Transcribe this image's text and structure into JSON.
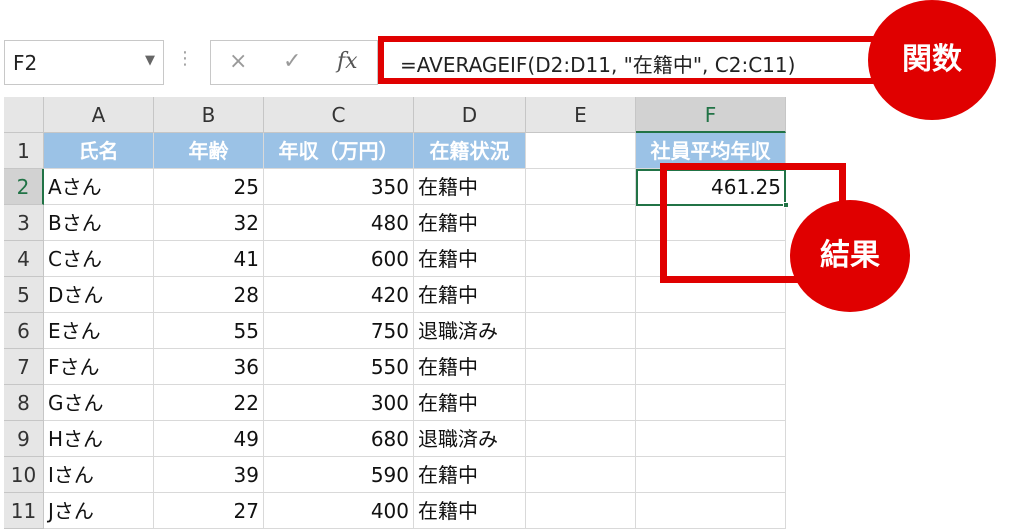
{
  "formula_bar": {
    "name_box": "F2",
    "cancel_icon": "×",
    "enter_icon": "✓",
    "fx_icon": "fx",
    "formula": "=AVERAGEIF(D2:D11, \"在籍中\", C2:C11)"
  },
  "columns": [
    "A",
    "B",
    "C",
    "D",
    "E",
    "F"
  ],
  "rows": [
    "1",
    "2",
    "3",
    "4",
    "5",
    "6",
    "7",
    "8",
    "9",
    "10",
    "11"
  ],
  "table": {
    "headers": [
      "氏名",
      "年齢",
      "年収（万円）",
      "在籍状況"
    ],
    "rows": [
      {
        "name": "Aさん",
        "age": "25",
        "income": "350",
        "status": "在籍中"
      },
      {
        "name": "Bさん",
        "age": "32",
        "income": "480",
        "status": "在籍中"
      },
      {
        "name": "Cさん",
        "age": "41",
        "income": "600",
        "status": "在籍中"
      },
      {
        "name": "Dさん",
        "age": "28",
        "income": "420",
        "status": "在籍中"
      },
      {
        "name": "Eさん",
        "age": "55",
        "income": "750",
        "status": "退職済み"
      },
      {
        "name": "Fさん",
        "age": "36",
        "income": "550",
        "status": "在籍中"
      },
      {
        "name": "Gさん",
        "age": "22",
        "income": "300",
        "status": "在籍中"
      },
      {
        "name": "Hさん",
        "age": "49",
        "income": "680",
        "status": "退職済み"
      },
      {
        "name": "Iさん",
        "age": "39",
        "income": "590",
        "status": "在籍中"
      },
      {
        "name": "Jさん",
        "age": "27",
        "income": "400",
        "status": "在籍中"
      }
    ]
  },
  "result": {
    "header": "社員平均年収",
    "value": "461.25"
  },
  "annotations": {
    "formula_label": "関数",
    "result_label": "結果"
  },
  "colors": {
    "header_fill": "#9bc2e6",
    "highlight": "#e00000",
    "selection": "#217346"
  }
}
